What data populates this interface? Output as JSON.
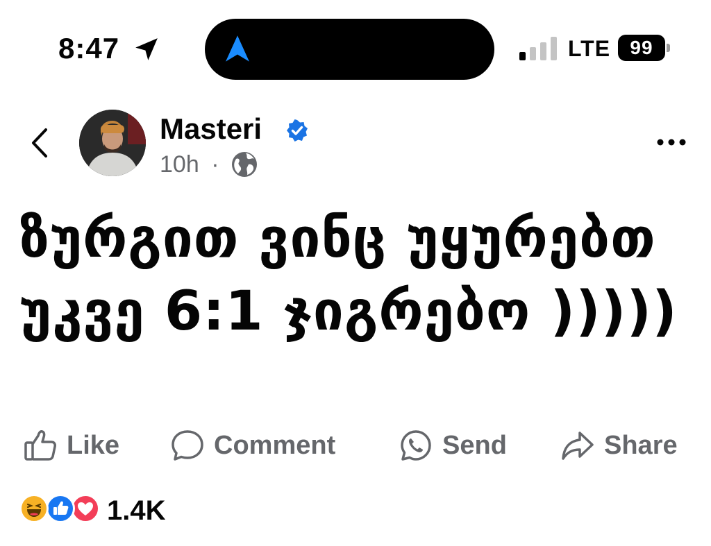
{
  "status_bar": {
    "time": "8:47",
    "network": "LTE",
    "battery": "99",
    "icons": [
      "location-arrow-icon",
      "maps-navigation-icon",
      "cellular-signal-icon",
      "battery-icon"
    ]
  },
  "post": {
    "author": "Masteri",
    "verified": true,
    "time_ago": "10h",
    "separator": "·",
    "audience_icon": "globe-icon",
    "text": "ზურგით ვინც უყურებთ უკვე 6:1 ჯიგრებო )))))"
  },
  "actions": {
    "like": "Like",
    "comment": "Comment",
    "send": "Send",
    "share": "Share"
  },
  "reactions": {
    "types": [
      "haha",
      "like",
      "love"
    ],
    "count": "1.4K"
  },
  "colors": {
    "verified_blue": "#1b74e4",
    "muted_text": "#65676b",
    "like_blue": "#1877f2",
    "love_red": "#f33e58",
    "haha_yellow": "#f7b125",
    "nav_blue": "#1a8cff"
  }
}
